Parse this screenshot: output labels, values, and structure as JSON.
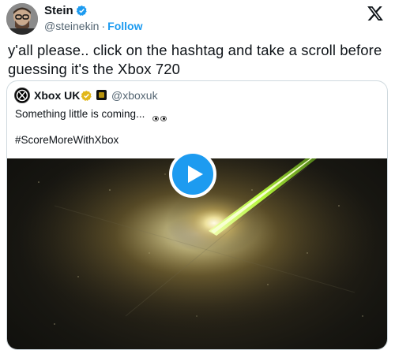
{
  "author": {
    "name": "Stein",
    "handle": "@steinekin",
    "separator": "·",
    "follow_label": "Follow"
  },
  "tweet_text": "y'all please.. click on the hashtag and take a scroll before guessing it's the Xbox 720",
  "quoted_tweet": {
    "name": "Xbox UK",
    "handle": "@xboxuk",
    "text": "Something little is coming...",
    "hashtag": "#ScoreMoreWithXbox"
  },
  "colors": {
    "accent": "#1d9bf0",
    "gold_badge": "#e2b719",
    "media_glow": "#b8ff3a"
  },
  "icons": [
    "verified-badge-icon",
    "x-logo-icon",
    "gold-verified-badge-icon",
    "affiliate-badge-icon",
    "eyes-emoji-icon",
    "play-icon"
  ]
}
